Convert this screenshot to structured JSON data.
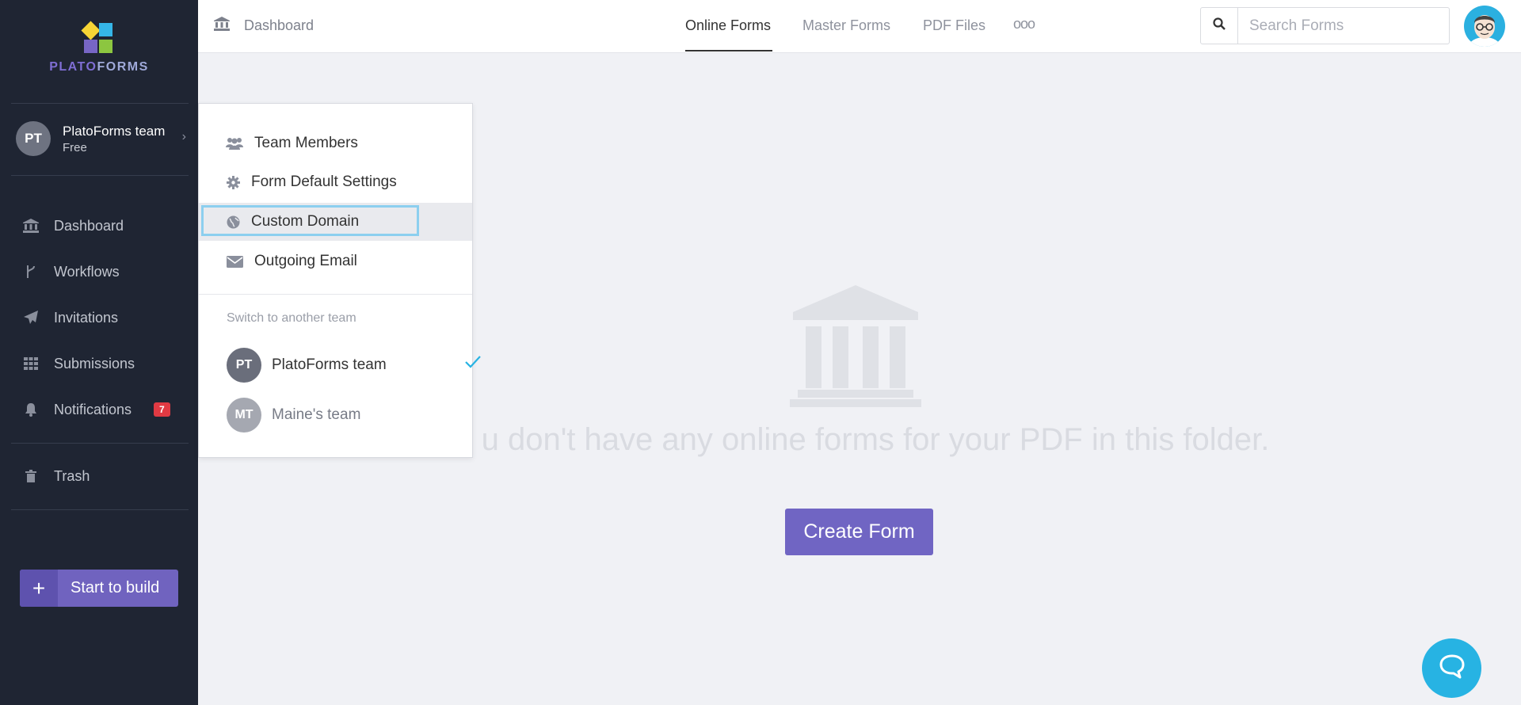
{
  "brand": {
    "part1": "PLATO",
    "part2": "FORMS",
    "accent": "#7063bf"
  },
  "sidebar": {
    "team": {
      "initials": "PT",
      "name": "PlatoForms team",
      "plan": "Free"
    },
    "items": [
      {
        "label": "Dashboard",
        "icon": "bank-icon"
      },
      {
        "label": "Workflows",
        "icon": "branch-icon"
      },
      {
        "label": "Invitations",
        "icon": "paper-plane-icon"
      },
      {
        "label": "Submissions",
        "icon": "grid-icon"
      },
      {
        "label": "Notifications",
        "icon": "bell-icon",
        "badge": "7"
      },
      {
        "label": "Trash",
        "icon": "trash-icon"
      }
    ],
    "start_label": "Start to build",
    "start_icon": "+"
  },
  "topbar": {
    "breadcrumb": "Dashboard",
    "tabs": [
      {
        "label": "Online Forms",
        "active": true
      },
      {
        "label": "Master Forms"
      },
      {
        "label": "PDF Files"
      },
      {
        "label": "ooo"
      }
    ],
    "search_placeholder": "Search Forms"
  },
  "main": {
    "empty_text": "u don't have any online forms for your PDF in this folder.",
    "create_label": "Create Form"
  },
  "menu": {
    "items": [
      {
        "label": "Team Members",
        "icon": "users-icon"
      },
      {
        "label": "Form Default Settings",
        "icon": "gear-icon"
      },
      {
        "label": "Custom Domain",
        "icon": "globe-icon"
      },
      {
        "label": "Outgoing Email",
        "icon": "envelope-icon"
      }
    ],
    "switch_heading": "Switch to another team",
    "teams": [
      {
        "initials": "PT",
        "name": "PlatoForms team",
        "selected": true
      },
      {
        "initials": "MT",
        "name": "Maine's team"
      }
    ]
  }
}
